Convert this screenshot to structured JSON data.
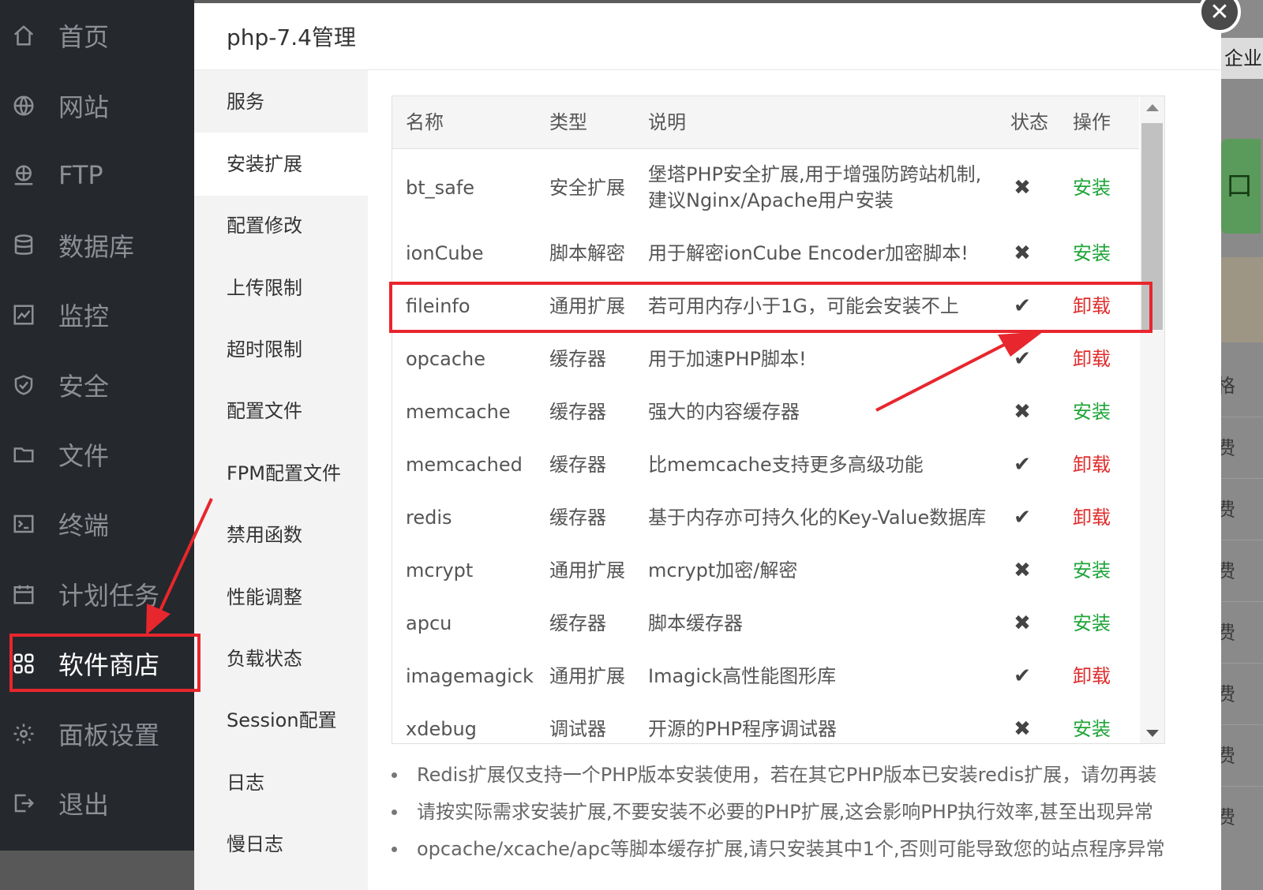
{
  "sidebar": {
    "items": [
      {
        "label": "首页",
        "icon": "home-icon"
      },
      {
        "label": "网站",
        "icon": "globe-icon"
      },
      {
        "label": "FTP",
        "icon": "ftp-icon"
      },
      {
        "label": "数据库",
        "icon": "database-icon"
      },
      {
        "label": "监控",
        "icon": "monitor-icon"
      },
      {
        "label": "安全",
        "icon": "shield-icon"
      },
      {
        "label": "文件",
        "icon": "folder-icon"
      },
      {
        "label": "终端",
        "icon": "terminal-icon"
      },
      {
        "label": "计划任务",
        "icon": "calendar-icon"
      },
      {
        "label": "软件商店",
        "icon": "apps-icon"
      },
      {
        "label": "面板设置",
        "icon": "gear-icon"
      },
      {
        "label": "退出",
        "icon": "logout-icon"
      }
    ],
    "active_index": 9
  },
  "background": {
    "enterprise_label": "企业",
    "green_button_label": "口",
    "price_label": "格",
    "fee_label": "费"
  },
  "modal": {
    "title": "php-7.4管理",
    "tabs": [
      "服务",
      "安装扩展",
      "配置修改",
      "上传限制",
      "超时限制",
      "配置文件",
      "FPM配置文件",
      "禁用函数",
      "性能调整",
      "负载状态",
      "Session配置",
      "日志",
      "慢日志"
    ],
    "active_tab": 1,
    "table": {
      "headers": {
        "name": "名称",
        "type": "类型",
        "desc": "说明",
        "status": "状态",
        "op": "操作"
      },
      "rows": [
        {
          "name": "bt_safe",
          "type": "安全扩展",
          "desc1": "堡塔PHP安全扩展,用于增强防跨站机制,",
          "desc2": "建议Nginx/Apache用户安装",
          "status": "✖",
          "op": "安装",
          "installed": false
        },
        {
          "name": "ionCube",
          "type": "脚本解密",
          "desc1": "用于解密ionCube Encoder加密脚本!",
          "status": "✖",
          "op": "安装",
          "installed": false
        },
        {
          "name": "fileinfo",
          "type": "通用扩展",
          "desc1": "若可用内存小于1G，可能会安装不上",
          "status": "✔",
          "op": "卸载",
          "installed": true
        },
        {
          "name": "opcache",
          "type": "缓存器",
          "desc1": "用于加速PHP脚本!",
          "status": "✔",
          "op": "卸载",
          "installed": true
        },
        {
          "name": "memcache",
          "type": "缓存器",
          "desc1": "强大的内容缓存器",
          "status": "✖",
          "op": "安装",
          "installed": false
        },
        {
          "name": "memcached",
          "type": "缓存器",
          "desc1": "比memcache支持更多高级功能",
          "status": "✔",
          "op": "卸载",
          "installed": true
        },
        {
          "name": "redis",
          "type": "缓存器",
          "desc1": "基于内存亦可持久化的Key-Value数据库",
          "status": "✔",
          "op": "卸载",
          "installed": true
        },
        {
          "name": "mcrypt",
          "type": "通用扩展",
          "desc1": "mcrypt加密/解密",
          "status": "✖",
          "op": "安装",
          "installed": false
        },
        {
          "name": "apcu",
          "type": "缓存器",
          "desc1": "脚本缓存器",
          "status": "✖",
          "op": "安装",
          "installed": false
        },
        {
          "name": "imagemagick",
          "type": "通用扩展",
          "desc1": "Imagick高性能图形库",
          "status": "✔",
          "op": "卸载",
          "installed": true
        },
        {
          "name": "xdebug",
          "type": "调试器",
          "desc1": "开源的PHP程序调试器",
          "status": "✖",
          "op": "安装",
          "installed": false
        }
      ]
    },
    "notes": [
      "Redis扩展仅支持一个PHP版本安装使用，若在其它PHP版本已安装redis扩展，请勿再装",
      "请按实际需求安装扩展,不要安装不必要的PHP扩展,这会影响PHP执行效率,甚至出现异常",
      "opcache/xcache/apc等脚本缓存扩展,请只安装其中1个,否则可能导致您的站点程序异常"
    ],
    "close_icon": "close-icon"
  },
  "colors": {
    "sidebar_bg": "#25282d",
    "install_green": "#20a53a",
    "uninstall_red": "#e02d2d",
    "annotation_red": "#e8262d"
  }
}
